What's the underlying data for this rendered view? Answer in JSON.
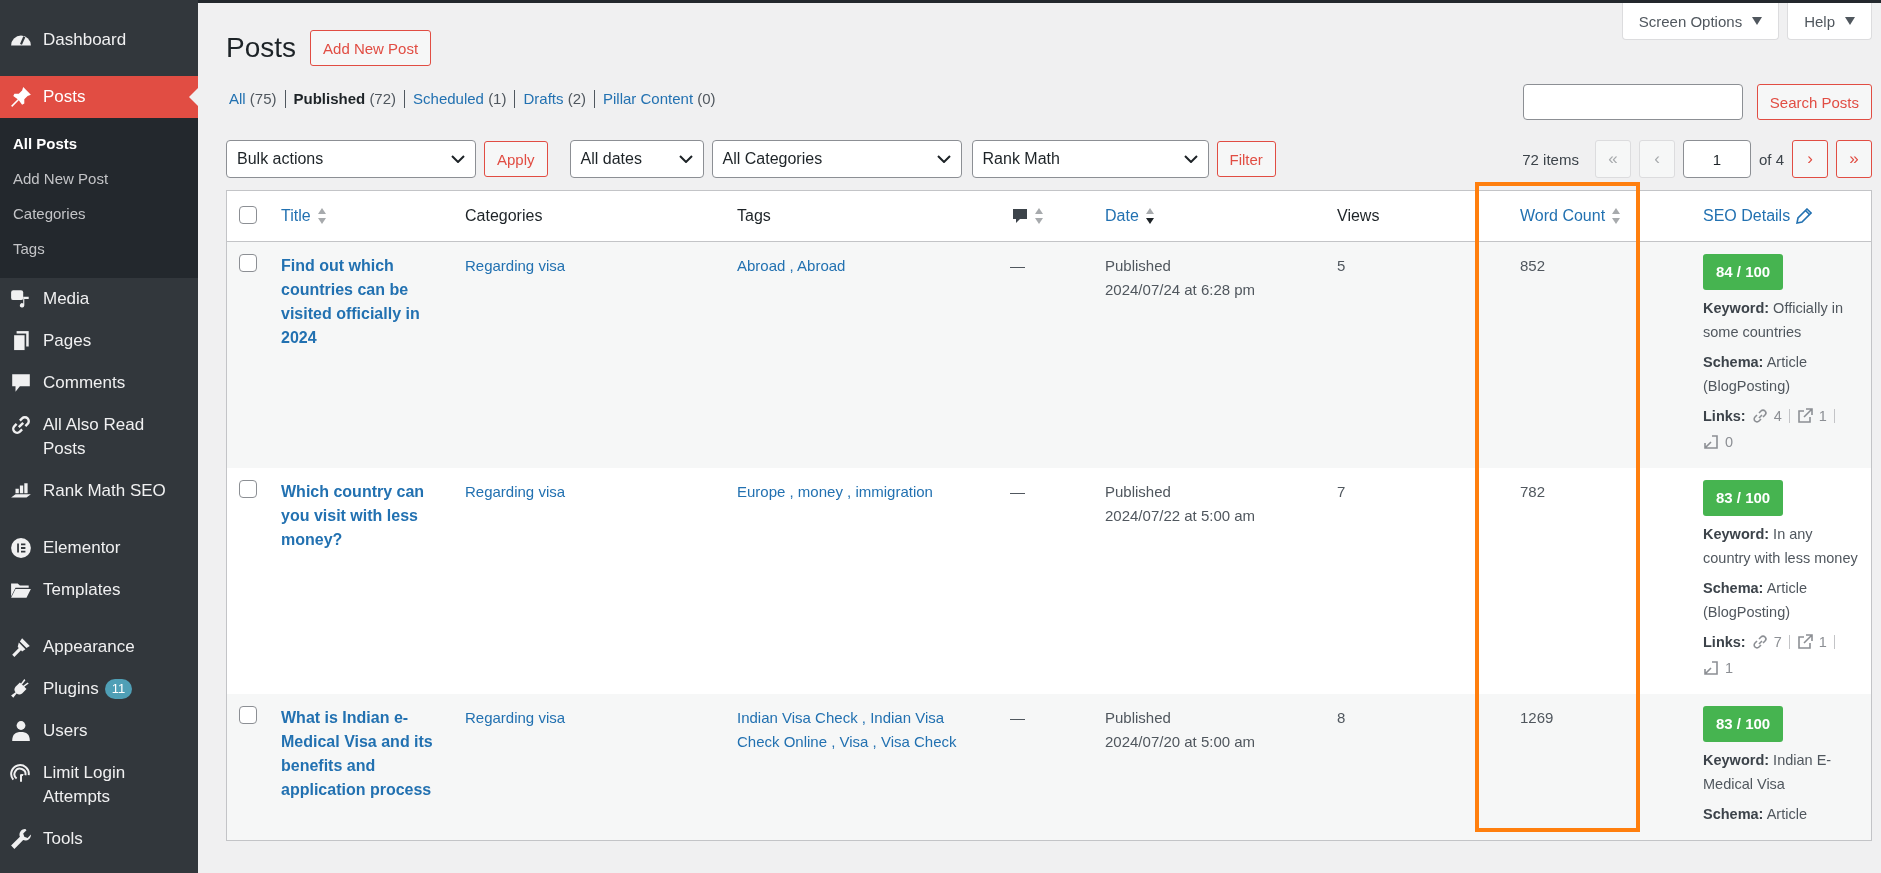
{
  "sidebar": {
    "groups": [
      {
        "items": [
          {
            "label": "Dashboard",
            "selected": false
          }
        ]
      },
      {
        "items": [
          {
            "label": "Posts",
            "selected": true,
            "children": [
              {
                "label": "All Posts",
                "selected": true
              },
              {
                "label": "Add New Post",
                "selected": false
              },
              {
                "label": "Categories",
                "selected": false
              },
              {
                "label": "Tags",
                "selected": false
              }
            ]
          },
          {
            "label": "Media",
            "selected": false
          },
          {
            "label": "Pages",
            "selected": false
          },
          {
            "label": "Comments",
            "selected": false
          },
          {
            "label": "All Also Read Posts",
            "selected": false
          },
          {
            "label": "Rank Math SEO",
            "selected": false
          }
        ]
      },
      {
        "items": [
          {
            "label": "Elementor",
            "selected": false
          },
          {
            "label": "Templates",
            "selected": false
          }
        ]
      },
      {
        "items": [
          {
            "label": "Appearance",
            "selected": false
          },
          {
            "label": "Plugins",
            "selected": false,
            "badge": "11"
          },
          {
            "label": "Users",
            "selected": false
          },
          {
            "label": "Limit Login Attempts",
            "selected": false
          },
          {
            "label": "Tools",
            "selected": false
          }
        ]
      }
    ]
  },
  "header": {
    "title": "Posts",
    "add_button": "Add New Post"
  },
  "meta_buttons": [
    "Screen Options",
    "Help"
  ],
  "views": [
    {
      "label": "All",
      "count": "(75)",
      "selected": false
    },
    {
      "label": "Published",
      "count": "(72)",
      "selected": true
    },
    {
      "label": "Scheduled",
      "count": "(1)",
      "selected": false
    },
    {
      "label": "Drafts",
      "count": "(2)",
      "selected": false
    },
    {
      "label": "Pillar Content",
      "count": "(0)",
      "selected": false
    }
  ],
  "search": {
    "button": "Search Posts"
  },
  "filters": {
    "bulk": "Bulk actions",
    "apply": "Apply",
    "selects": [
      "All dates",
      "All Categories",
      "Rank Math"
    ],
    "filter_button": "Filter"
  },
  "pagination": {
    "items": "72 items",
    "page": "1",
    "of": "of 4",
    "buttons": [
      {
        "label": "«",
        "disabled": true
      },
      {
        "label": "‹",
        "disabled": true
      },
      {
        "label": "›",
        "disabled": false
      },
      {
        "label": "»",
        "disabled": false
      }
    ]
  },
  "table": {
    "select_all": {
      "checked": false
    },
    "columns": [
      {
        "label": "Title",
        "sortable": true,
        "sorted_desc": false
      },
      {
        "label": "Categories"
      },
      {
        "label": "Tags"
      },
      {
        "kind": "comments",
        "sortable": true,
        "sorted_desc": false
      },
      {
        "label": "Date",
        "sortable": true,
        "sorted_desc": true
      },
      {
        "label": "Views"
      },
      {
        "label": "Word Count",
        "sortable": true,
        "sorted_desc": false,
        "highlighted": true
      },
      {
        "label": "SEO Details",
        "kind": "editable"
      }
    ],
    "rows": [
      {
        "checked": false,
        "title": "Find out which countries can be visited officially in 2024",
        "category": "Regarding visa",
        "tags": "Abroad , Abroad",
        "comments": "—",
        "status": "Published",
        "date": "2024/07/24 at 6:28 pm",
        "views": "5",
        "word_count": "852",
        "seo": {
          "score": "84 / 100",
          "keyword": "**Keyword:** Officially in some countries",
          "schema": "**Schema:** Article (BlogPosting)",
          "links_label": "Links:",
          "links": [
            "4",
            "1",
            "0"
          ]
        }
      },
      {
        "checked": false,
        "title": "Which country can you visit with less money?",
        "category": "Regarding visa",
        "tags": "Europe , money , immigration",
        "comments": "—",
        "status": "Published",
        "date": "2024/07/22 at 5:00 am",
        "views": "7",
        "word_count": "782",
        "seo": {
          "score": "83 / 100",
          "keyword": "**Keyword:** In any country with less money",
          "schema": "**Schema:** Article (BlogPosting)",
          "links_label": "Links:",
          "links": [
            "7",
            "1",
            "1"
          ]
        }
      },
      {
        "checked": false,
        "title": "What is Indian e-Medical Visa and its benefits and application process",
        "category": "Regarding visa",
        "tags": "Indian Visa Check , Indian Visa Check Online , Visa , Visa Check",
        "comments": "—",
        "status": "Published",
        "date": "2024/07/20 at 5:00 am",
        "views": "8",
        "word_count": "1269",
        "seo": {
          "score": "83 / 100",
          "keyword": "**Keyword:** Indian E-Medical Visa",
          "schema": "**Schema:** Article"
        }
      }
    ]
  }
}
